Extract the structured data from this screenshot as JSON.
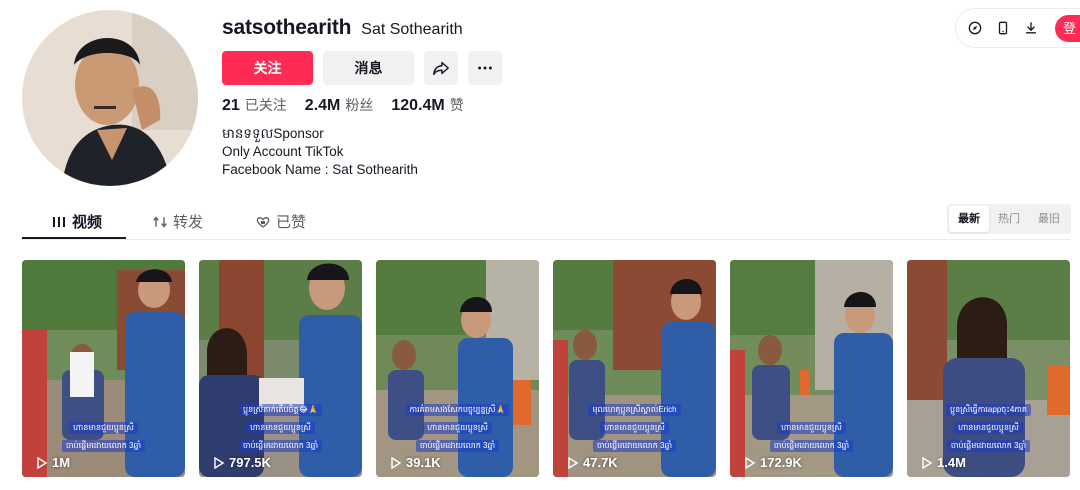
{
  "profile": {
    "username": "satsothearith",
    "nickname": "Sat Sothearith",
    "follow_label": "关注",
    "message_label": "消息",
    "stats": [
      {
        "value": "21",
        "label": "已关注"
      },
      {
        "value": "2.4M",
        "label": "粉丝"
      },
      {
        "value": "120.4M",
        "label": "赞"
      }
    ],
    "bio": [
      "មានទទួលSponsor",
      "Only Account TikTok",
      "Facebook Name : Sat Sothearith"
    ]
  },
  "topbar": {
    "icons": [
      "compass-icon",
      "phone-icon",
      "download-icon"
    ],
    "login_label": "登"
  },
  "tabs": [
    {
      "label": "视频",
      "icon": "grid-icon"
    },
    {
      "label": "转发",
      "icon": "repost-icon"
    },
    {
      "label": "已赞",
      "icon": "liked-icon"
    }
  ],
  "sort": {
    "options": [
      "最新",
      "热门",
      "最旧"
    ],
    "selected": "最新"
  },
  "videos": [
    {
      "views": "1M",
      "captions": [
        "ហានមានជួយប្អូនស្រី",
        "ចាប់ផ្ដើមដោយលោក 3ឆ្នាំ"
      ]
    },
    {
      "views": "797.5K",
      "captions": [
        "ប្អូនស្រីតាក់តើបចិត្ត😂🙏",
        "ហានមានជួយប្អូនស្រី",
        "ចាប់ផ្ដើមដោយលោក 3ឆ្នាំ"
      ]
    },
    {
      "views": "39.1K",
      "captions": [
        "ការគំរាមសងសែកបច្ចុប្បន្នស្រី🙏",
        "ហានមានជួយប្អូនស្រី",
        "ចាប់ផ្ដើមដោយលោក 3ឆ្នាំ"
      ]
    },
    {
      "views": "47.7K",
      "captions": [
        "មុលហេតុប្អូនស្រីស្គាល់Erich",
        "ហានមានជួយប្អូនស្រី",
        "ចាប់ផ្ដើមដោយលោក 3ឆ្នាំ"
      ]
    },
    {
      "views": "172.9K",
      "captions": [
        "ហានមានជួយប្អូនស្រី",
        "ចាប់ផ្ដើមដោយលោក 3ឆ្នាំ"
      ]
    },
    {
      "views": "1.4M",
      "captions": [
        "ប្អូនស្រីធ្វើការappចុះ4ភាគ",
        "ហានមានជួយប្អូនស្រី",
        "ចាប់ផ្ដើមដោយលោក 3ឆ្នាំ"
      ]
    }
  ],
  "colors": {
    "accent": "#fe2c55",
    "caption_bg": "#3c50c8"
  }
}
